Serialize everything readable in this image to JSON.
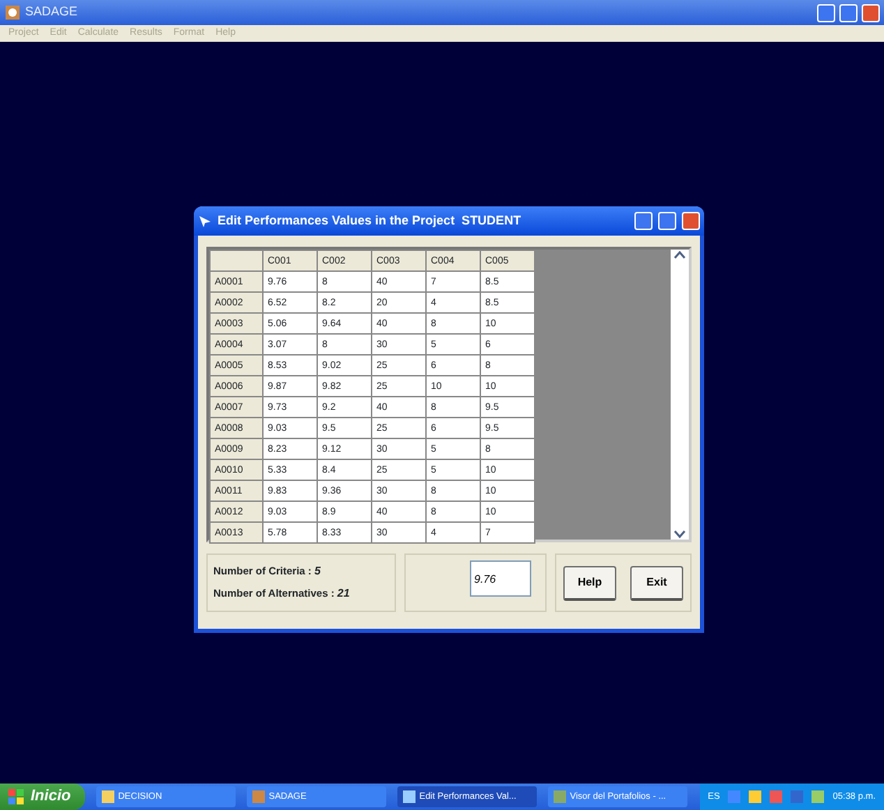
{
  "window": {
    "title": "SADAGE"
  },
  "menu": [
    {
      "label": "Project",
      "disabled": true
    },
    {
      "label": "Edit",
      "disabled": true
    },
    {
      "label": "Calculate",
      "disabled": true
    },
    {
      "label": "Results",
      "disabled": true
    },
    {
      "label": "Format",
      "disabled": true
    },
    {
      "label": "Help",
      "disabled": true
    }
  ],
  "dialog": {
    "title": "Edit Performances Values in the Project  STUDENT",
    "table": {
      "columns": [
        "C001",
        "C002",
        "C003",
        "C004",
        "C005"
      ],
      "rows": [
        {
          "header": "A0001",
          "cells": [
            "9.76",
            "8",
            "40",
            "7",
            "8.5"
          ]
        },
        {
          "header": "A0002",
          "cells": [
            "6.52",
            "8.2",
            "20",
            "4",
            "8.5"
          ]
        },
        {
          "header": "A0003",
          "cells": [
            "5.06",
            "9.64",
            "40",
            "8",
            "10"
          ]
        },
        {
          "header": "A0004",
          "cells": [
            "3.07",
            "8",
            "30",
            "5",
            "6"
          ]
        },
        {
          "header": "A0005",
          "cells": [
            "8.53",
            "9.02",
            "25",
            "6",
            "8"
          ]
        },
        {
          "header": "A0006",
          "cells": [
            "9.87",
            "9.82",
            "25",
            "10",
            "10"
          ]
        },
        {
          "header": "A0007",
          "cells": [
            "9.73",
            "9.2",
            "40",
            "8",
            "9.5"
          ]
        },
        {
          "header": "A0008",
          "cells": [
            "9.03",
            "9.5",
            "25",
            "6",
            "9.5"
          ]
        },
        {
          "header": "A0009",
          "cells": [
            "8.23",
            "9.12",
            "30",
            "5",
            "8"
          ]
        },
        {
          "header": "A0010",
          "cells": [
            "5.33",
            "8.4",
            "25",
            "5",
            "10"
          ]
        },
        {
          "header": "A0011",
          "cells": [
            "9.83",
            "9.36",
            "30",
            "8",
            "10"
          ]
        },
        {
          "header": "A0012",
          "cells": [
            "9.03",
            "8.9",
            "40",
            "8",
            "10"
          ]
        },
        {
          "header": "A0013",
          "cells": [
            "5.78",
            "8.33",
            "30",
            "4",
            "7"
          ]
        }
      ]
    },
    "info": [
      {
        "label": "Number of Criteria :",
        "value": "5"
      },
      {
        "label": "Number of Alternatives :",
        "value": "21"
      }
    ],
    "edit_value": "9.76",
    "buttons": [
      "Help",
      "Exit"
    ]
  },
  "taskbar": {
    "start": "Inicio",
    "items": [
      {
        "label": "DECISION",
        "kind": "folder",
        "selected": false
      },
      {
        "label": "SADAGE",
        "kind": "app",
        "selected": false
      },
      {
        "label": "Edit Performances Val...",
        "kind": "dialog",
        "selected": true
      },
      {
        "label": "Visor del Portafolios - ...",
        "kind": "viewer",
        "selected": false
      }
    ],
    "language": "ES",
    "clock": "05:38 p.m."
  }
}
